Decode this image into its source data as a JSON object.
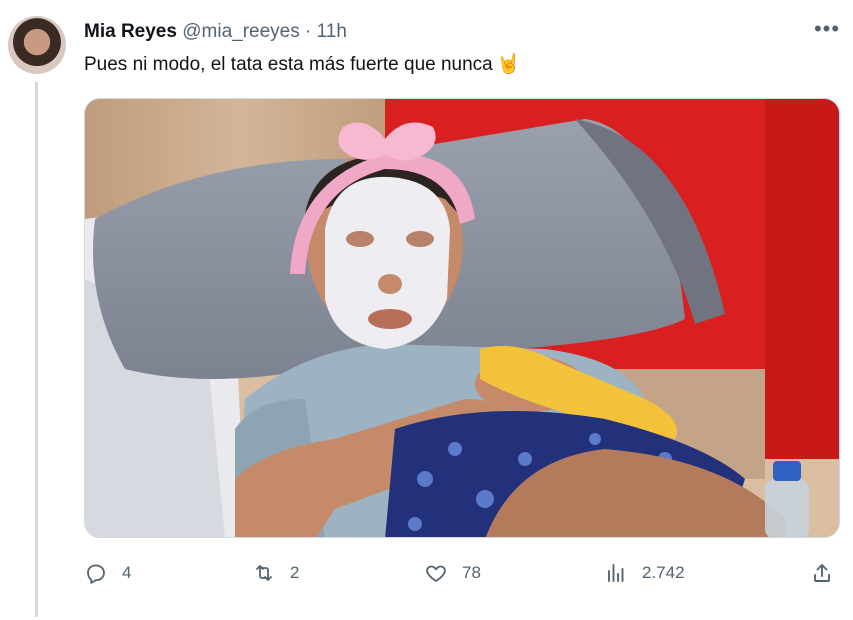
{
  "tweet": {
    "author_name": "Mia Reyes",
    "handle": "@mia_reeyes",
    "separator": "·",
    "time": "11h",
    "more_label": "•••",
    "text": "Pues ni modo, el tata esta más fuerte que nunca",
    "emoji": "🤘",
    "media_description": "man-with-face-mask-lying-in-bed",
    "stats": {
      "replies": "4",
      "retweets": "2",
      "likes": "78",
      "views": "2.742"
    }
  },
  "icons": {
    "reply": "reply-icon",
    "retweet": "retweet-icon",
    "like": "like-icon",
    "views": "views-icon",
    "share": "share-icon"
  },
  "colors": {
    "text": "#0f1419",
    "secondary": "#536471",
    "divider": "#cfd9de",
    "wall_red": "#d91f1f"
  }
}
